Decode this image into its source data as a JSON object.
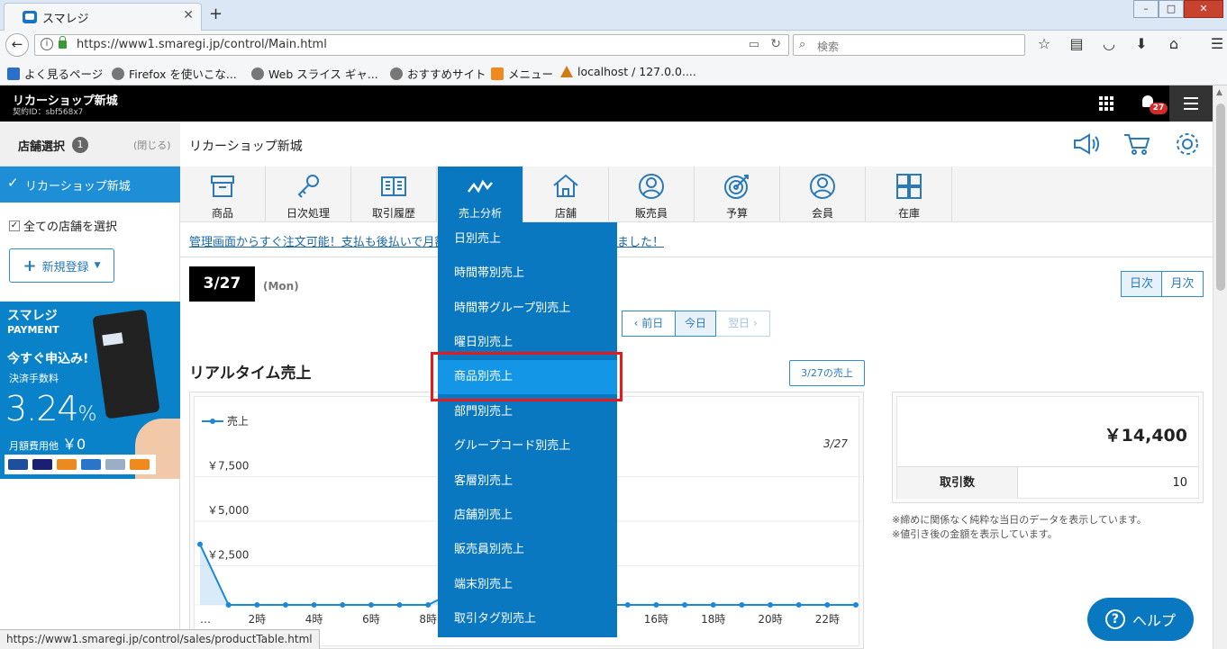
{
  "browser": {
    "tab_title": "スマレジ",
    "tab_close": "✕",
    "new_tab": "+",
    "url": "https://www1.smaregi.jp/control/Main.html",
    "search_placeholder": "検索",
    "bookmarks": [
      {
        "label": "よく見るページ",
        "icon": "gear-icon"
      },
      {
        "label": "Firefox を使いこな...",
        "icon": "globe-icon"
      },
      {
        "label": "Web スライス ギャ...",
        "icon": "globe-icon"
      },
      {
        "label": "おすすめサイト",
        "icon": "globe-icon"
      },
      {
        "label": "メニュー",
        "icon": "menu-icon"
      },
      {
        "label": "localhost / 127.0.0....",
        "icon": "phpmyadmin-icon"
      }
    ],
    "status_url": "https://www1.smaregi.jp/control/sales/productTable.html"
  },
  "header": {
    "shop_name": "リカーショップ新城",
    "contract_id": "契約ID：sbf568x7",
    "notification_count": "27"
  },
  "sidebar": {
    "title": "店舗選択",
    "count": "1",
    "close_label": "(閉じる)",
    "selected_store": "リカーショップ新城",
    "select_all_label": "全ての店舗を選択",
    "new_button": "新規登録",
    "banner": {
      "brand": "スマレジ",
      "brand_sub": "PAYMENT",
      "cta": "今すぐ申込み!",
      "fee_label": "決済手数料",
      "rate": "3.24",
      "rate_unit": "%",
      "monthly_label": "月額費用他",
      "monthly_value": "￥0"
    }
  },
  "main": {
    "title": "リカーショップ新城",
    "nav_items": [
      {
        "label": "商品",
        "icon": "box-icon"
      },
      {
        "label": "日次処理",
        "icon": "key-icon"
      },
      {
        "label": "取引履歴",
        "icon": "book-icon"
      },
      {
        "label": "売上分析",
        "icon": "chart-icon",
        "active": true
      },
      {
        "label": "店舗",
        "icon": "home-icon"
      },
      {
        "label": "販売員",
        "icon": "person-icon"
      },
      {
        "label": "予算",
        "icon": "target-icon"
      },
      {
        "label": "会員",
        "icon": "member-icon"
      },
      {
        "label": "在庫",
        "icon": "grid-icon"
      }
    ],
    "notice": "管理画面からすぐ注文可能！支払も後払いで月額費",
    "notice_tail": "ました！",
    "date": "3/27",
    "day_of_week": "(Mon)",
    "period_daily": "日次",
    "period_monthly": "月次",
    "prev_day": "前日",
    "today": "今日",
    "next_day": "翌日",
    "realtime_title": "リアルタイム売上",
    "day_sales_button": "3/27の売上",
    "total_amount": "￥14,400",
    "transactions_label": "取引数",
    "transactions_value": "10",
    "notes": [
      "※締めに関係なく純粋な当日のデータを表示しています。",
      "※値引き後の金額を表示しています。"
    ],
    "help_label": "ヘルプ"
  },
  "dropdown": {
    "items": [
      {
        "label": "日別売上"
      },
      {
        "label": "時間帯別売上"
      },
      {
        "label": "時間帯グループ別売上"
      },
      {
        "label": "曜日別売上"
      },
      {
        "label": "商品別売上",
        "highlighted": true
      },
      {
        "label": "部門別売上"
      },
      {
        "label": "グループコード別売上"
      },
      {
        "label": "客層別売上"
      },
      {
        "label": "店舗別売上"
      },
      {
        "label": "販売員別売上"
      },
      {
        "label": "端末別売上"
      },
      {
        "label": "取引タグ別売上"
      }
    ]
  },
  "chart_data": {
    "type": "line",
    "legend": "売上",
    "date_label": "3/27",
    "yticks": [
      "￥7,500",
      "￥5,000",
      "￥2,500"
    ],
    "xticks": [
      "…",
      "2時",
      "4時",
      "6時",
      "8時",
      "16時",
      "18時",
      "20時",
      "22時"
    ],
    "series": [
      {
        "name": "売上",
        "x": [
          0,
          1,
          2,
          3,
          4,
          5,
          6,
          7,
          8,
          9,
          10,
          11,
          12,
          13,
          14,
          15,
          16,
          17,
          18,
          19,
          20,
          21,
          22,
          23
        ],
        "values": [
          3400,
          0,
          0,
          0,
          0,
          0,
          0,
          0,
          0,
          800,
          0,
          0,
          0,
          0,
          0,
          0,
          0,
          0,
          0,
          0,
          0,
          0,
          0,
          0
        ]
      }
    ]
  }
}
